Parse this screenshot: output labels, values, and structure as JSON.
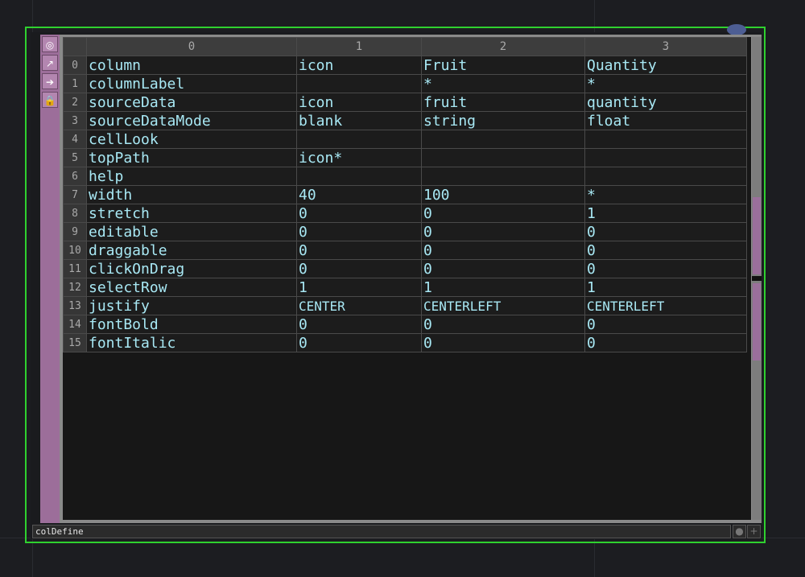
{
  "operator": {
    "name": "colDefine",
    "sidebar_icons": [
      "viewer-icon",
      "bypass-icon",
      "export-icon",
      "lock-icon"
    ],
    "sidebar_glyphs": [
      "◎",
      "↗",
      "➔",
      "🔒"
    ],
    "namebar_buttons": [
      "●",
      "+"
    ]
  },
  "table": {
    "column_headers": [
      "0",
      "1",
      "2",
      "3"
    ],
    "rows": [
      {
        "index": "0",
        "cells": [
          "column",
          "icon",
          "Fruit",
          "Quantity"
        ]
      },
      {
        "index": "1",
        "cells": [
          "columnLabel",
          "",
          "*",
          "*"
        ]
      },
      {
        "index": "2",
        "cells": [
          "sourceData",
          "icon",
          "fruit",
          "quantity"
        ]
      },
      {
        "index": "3",
        "cells": [
          "sourceDataMode",
          "blank",
          "string",
          "float"
        ]
      },
      {
        "index": "4",
        "cells": [
          "cellLook",
          "",
          "",
          ""
        ]
      },
      {
        "index": "5",
        "cells": [
          "topPath",
          "icon*",
          "",
          ""
        ]
      },
      {
        "index": "6",
        "cells": [
          "help",
          "",
          "",
          ""
        ]
      },
      {
        "index": "7",
        "cells": [
          "width",
          "40",
          "100",
          "*"
        ]
      },
      {
        "index": "8",
        "cells": [
          "stretch",
          "0",
          "0",
          "1"
        ]
      },
      {
        "index": "9",
        "cells": [
          "editable",
          "0",
          "0",
          "0"
        ]
      },
      {
        "index": "10",
        "cells": [
          "draggable",
          "0",
          "0",
          "0"
        ]
      },
      {
        "index": "11",
        "cells": [
          "clickOnDrag",
          "0",
          "0",
          "0"
        ]
      },
      {
        "index": "12",
        "cells": [
          "selectRow",
          "1",
          "1",
          "1"
        ]
      },
      {
        "index": "13",
        "cells": [
          "justify",
          "CENTER",
          "CENTERLEFT",
          "CENTERLEFT"
        ]
      },
      {
        "index": "14",
        "cells": [
          "fontBold",
          "0",
          "0",
          "0"
        ]
      },
      {
        "index": "15",
        "cells": [
          "fontItalic",
          "0",
          "0",
          "0"
        ]
      }
    ]
  },
  "colors": {
    "selection_outline": "#2fd12f",
    "sidebar": "#9c6e9a",
    "cell_text": "#a8e8f4"
  }
}
